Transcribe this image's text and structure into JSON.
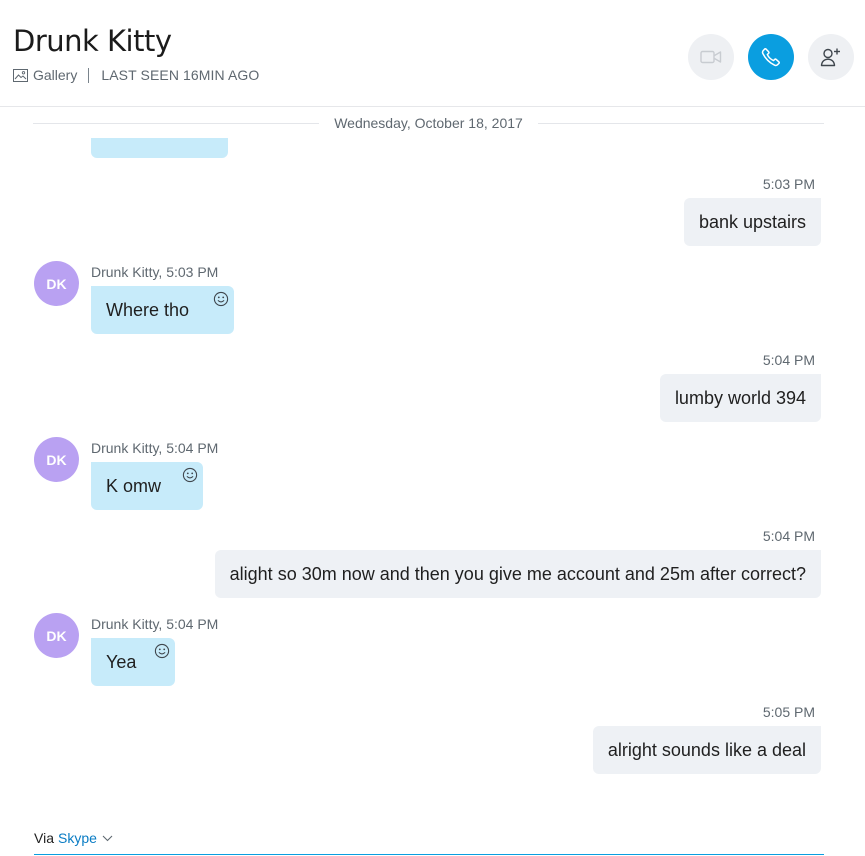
{
  "header": {
    "contact_name": "Drunk Kitty",
    "gallery_label": "Gallery",
    "last_seen": "LAST SEEN 16MIN AGO",
    "buttons": [
      "video-call",
      "audio-call",
      "add-people"
    ]
  },
  "date_divider": "Wednesday, October 18, 2017",
  "messages": [
    {
      "direction": "out",
      "time": "5:03 PM",
      "text": "bank upstairs"
    },
    {
      "direction": "in",
      "avatar": "DK",
      "sender": "Drunk Kitty,",
      "time": "5:03 PM",
      "text": "Where tho"
    },
    {
      "direction": "out",
      "time": "5:04 PM",
      "text": "lumby world 394"
    },
    {
      "direction": "in",
      "avatar": "DK",
      "sender": "Drunk Kitty,",
      "time": "5:04 PM",
      "text": "K omw"
    },
    {
      "direction": "out",
      "time": "5:04 PM",
      "text": "alight so 30m now and then you give me account and 25m after correct?"
    },
    {
      "direction": "in",
      "avatar": "DK",
      "sender": "Drunk Kitty,",
      "time": "5:04 PM",
      "text": "Yea"
    },
    {
      "direction": "out",
      "time": "5:05 PM",
      "text": "alright sounds like a deal"
    }
  ],
  "footer": {
    "via_label": "Via",
    "via_service": "Skype"
  },
  "colors": {
    "accent": "#0a9ee0",
    "incoming_bubble": "#c7ebfa",
    "outgoing_bubble": "#eef1f5",
    "avatar": "#b9a1f2"
  }
}
